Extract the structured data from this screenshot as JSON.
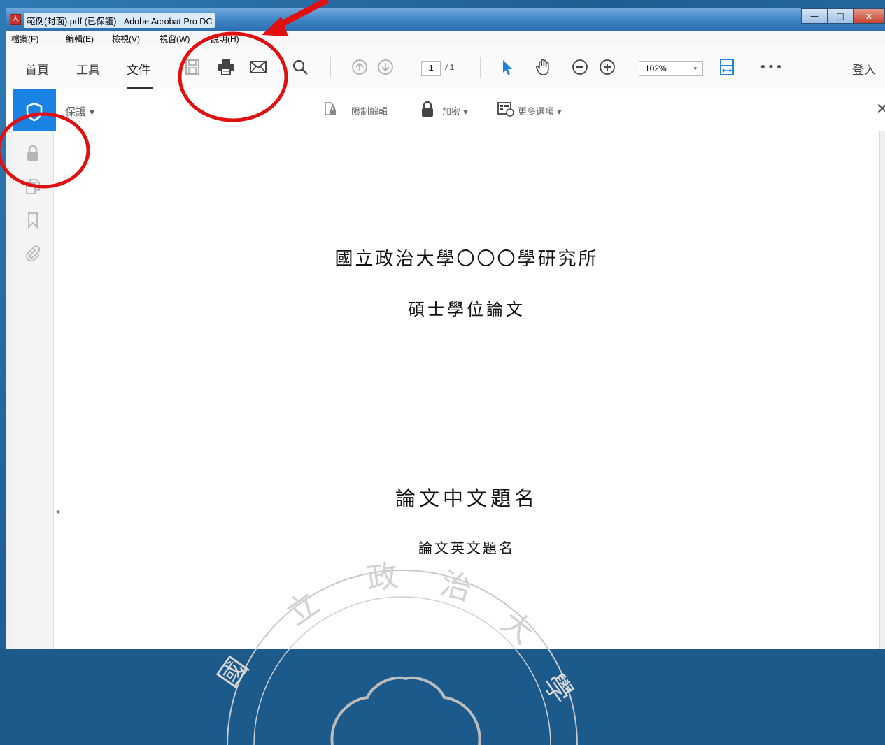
{
  "window": {
    "title": "範例(封面).pdf (已保護) - Adobe Acrobat Pro DC",
    "app_icon_glyph": "人",
    "controls": {
      "minimize": "—",
      "maximize": "□",
      "close": "x"
    }
  },
  "menubar": {
    "items": [
      "檔案(F)",
      "編輯(E)",
      "檢視(V)",
      "視窗(W)",
      "說明(H)"
    ]
  },
  "toolbar": {
    "tabs": [
      "首頁",
      "工具",
      "文件"
    ],
    "active_tab": "文件",
    "page_current": "1",
    "page_total": "/1",
    "zoom": "102%",
    "zoom_arrow": "▾",
    "more": "•••",
    "sign_in": "登入",
    "icons": [
      "save-icon",
      "print-icon",
      "email-icon",
      "search-icon",
      "page-up-icon",
      "page-down-icon",
      "select-cursor-icon",
      "hand-tool-icon",
      "zoom-out-icon",
      "zoom-in-icon",
      "fit-width-icon"
    ]
  },
  "protect_bar": {
    "label": "保護 ▾",
    "restrict_edit": "限制編輯",
    "encrypt": "加密 ▾",
    "more_options": "更多選項 ▾",
    "close": "✕"
  },
  "left_rail": {
    "icons": [
      "lock-icon",
      "pages-icon",
      "bookmark-icon",
      "attachment-icon"
    ],
    "collapse": "◂"
  },
  "document": {
    "line1": "國立政治大學〇〇〇學研究所",
    "line2": "碩士學位論文",
    "chinese_title": "論文中文題名",
    "english_title": "論文英文題名",
    "seal_chars": [
      "國",
      "立",
      "政",
      "治",
      "大",
      "學"
    ]
  },
  "colors": {
    "accent_blue": "#1a82e2",
    "annotation_red": "#e01010"
  }
}
